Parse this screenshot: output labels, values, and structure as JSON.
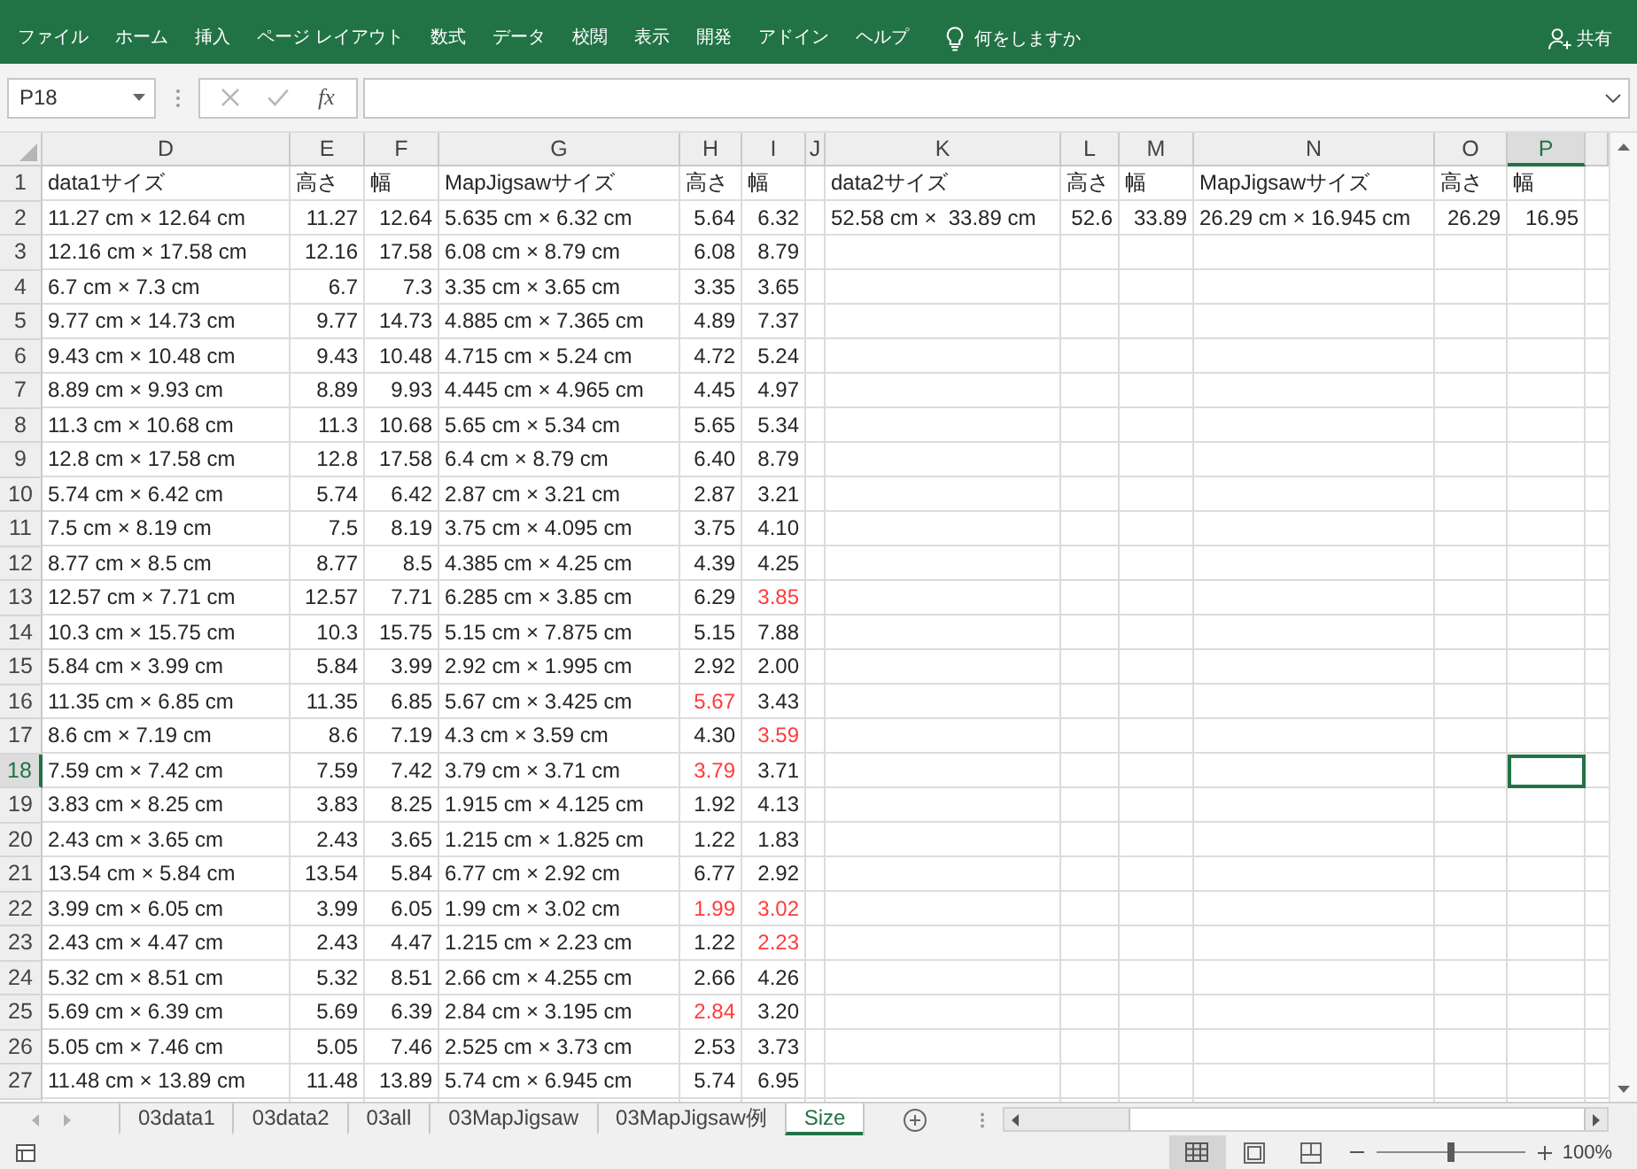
{
  "ribbon": {
    "tabs": [
      {
        "label": "ファイル",
        "selected": false
      },
      {
        "label": "ホーム",
        "selected": false
      },
      {
        "label": "挿入",
        "selected": false
      },
      {
        "label": "ページ レイアウト",
        "selected": false
      },
      {
        "label": "数式",
        "selected": false
      },
      {
        "label": "データ",
        "selected": false
      },
      {
        "label": "校閲",
        "selected": false
      },
      {
        "label": "表示",
        "selected": false
      },
      {
        "label": "開発",
        "selected": false
      },
      {
        "label": "アドイン",
        "selected": false
      },
      {
        "label": "ヘルプ",
        "selected": false
      }
    ],
    "tell_me": {
      "placeholder": "何をしますか"
    },
    "share": {
      "label": "共有"
    }
  },
  "formula_bar": {
    "name_box": {
      "value": "P18"
    },
    "cancel": {
      "disabled": true
    },
    "enter": {
      "disabled": true
    },
    "function_button": "fx"
  },
  "columns": [
    {
      "letter": "D",
      "kind": "text",
      "selected": false
    },
    {
      "letter": "E",
      "kind": "number",
      "selected": false
    },
    {
      "letter": "F",
      "kind": "number",
      "selected": false
    },
    {
      "letter": "G",
      "kind": "text",
      "selected": false
    },
    {
      "letter": "H",
      "kind": "number",
      "selected": false
    },
    {
      "letter": "I",
      "kind": "number",
      "selected": false
    },
    {
      "letter": "J",
      "kind": "spacer",
      "selected": false
    },
    {
      "letter": "K",
      "kind": "text",
      "selected": false
    },
    {
      "letter": "L",
      "kind": "number",
      "selected": false
    },
    {
      "letter": "M",
      "kind": "number",
      "selected": false
    },
    {
      "letter": "N",
      "kind": "text",
      "selected": false
    },
    {
      "letter": "O",
      "kind": "number",
      "selected": false
    },
    {
      "letter": "P",
      "kind": "number",
      "selected": true
    }
  ],
  "rows": [
    {
      "number": "1",
      "kind": "header",
      "selected": false,
      "cells": [
        {
          "text": "data1サイズ",
          "highlighted": false
        },
        {
          "text": "高さ",
          "highlighted": false
        },
        {
          "text": "幅",
          "highlighted": false
        },
        {
          "text": "MapJigsawサイズ",
          "highlighted": false
        },
        {
          "text": "高さ",
          "highlighted": false
        },
        {
          "text": "幅",
          "highlighted": false
        },
        {
          "text": "data2サイズ",
          "highlighted": false
        },
        {
          "text": "高さ",
          "highlighted": false
        },
        {
          "text": "幅",
          "highlighted": false
        },
        {
          "text": "MapJigsawサイズ",
          "highlighted": false
        },
        {
          "text": "高さ",
          "highlighted": false
        },
        {
          "text": "幅",
          "highlighted": false
        }
      ]
    },
    {
      "number": "2",
      "kind": "data",
      "selected": false,
      "cells": [
        {
          "text": "11.27 cm × 12.64 cm",
          "highlighted": false
        },
        {
          "text": "11.27",
          "highlighted": false
        },
        {
          "text": "12.64",
          "highlighted": false
        },
        {
          "text": "5.635 cm × 6.32 cm",
          "highlighted": false
        },
        {
          "text": "5.64",
          "highlighted": false
        },
        {
          "text": "6.32",
          "highlighted": false
        },
        {
          "text": "52.58 cm ×  33.89 cm",
          "highlighted": false
        },
        {
          "text": "52.6",
          "highlighted": false
        },
        {
          "text": "33.89",
          "highlighted": false
        },
        {
          "text": "26.29 cm × 16.945 cm",
          "highlighted": false
        },
        {
          "text": "26.29",
          "highlighted": false
        },
        {
          "text": "16.95",
          "highlighted": false
        }
      ]
    },
    {
      "number": "3",
      "kind": "data",
      "selected": false,
      "cells": [
        {
          "text": "12.16 cm × 17.58 cm",
          "highlighted": false
        },
        {
          "text": "12.16",
          "highlighted": false
        },
        {
          "text": "17.58",
          "highlighted": false
        },
        {
          "text": "6.08 cm × 8.79 cm",
          "highlighted": false
        },
        {
          "text": "6.08",
          "highlighted": false
        },
        {
          "text": "8.79",
          "highlighted": false
        }
      ]
    },
    {
      "number": "4",
      "kind": "data",
      "selected": false,
      "cells": [
        {
          "text": "6.7 cm × 7.3 cm",
          "highlighted": false
        },
        {
          "text": "6.7",
          "highlighted": false
        },
        {
          "text": "7.3",
          "highlighted": false
        },
        {
          "text": "3.35 cm × 3.65 cm",
          "highlighted": false
        },
        {
          "text": "3.35",
          "highlighted": false
        },
        {
          "text": "3.65",
          "highlighted": false
        }
      ]
    },
    {
      "number": "5",
      "kind": "data",
      "selected": false,
      "cells": [
        {
          "text": "9.77 cm × 14.73 cm",
          "highlighted": false
        },
        {
          "text": "9.77",
          "highlighted": false
        },
        {
          "text": "14.73",
          "highlighted": false
        },
        {
          "text": "4.885 cm × 7.365 cm",
          "highlighted": false
        },
        {
          "text": "4.89",
          "highlighted": false
        },
        {
          "text": "7.37",
          "highlighted": false
        }
      ]
    },
    {
      "number": "6",
      "kind": "data",
      "selected": false,
      "cells": [
        {
          "text": "9.43 cm × 10.48 cm",
          "highlighted": false
        },
        {
          "text": "9.43",
          "highlighted": false
        },
        {
          "text": "10.48",
          "highlighted": false
        },
        {
          "text": "4.715 cm × 5.24 cm",
          "highlighted": false
        },
        {
          "text": "4.72",
          "highlighted": false
        },
        {
          "text": "5.24",
          "highlighted": false
        }
      ]
    },
    {
      "number": "7",
      "kind": "data",
      "selected": false,
      "cells": [
        {
          "text": "8.89 cm × 9.93 cm",
          "highlighted": false
        },
        {
          "text": "8.89",
          "highlighted": false
        },
        {
          "text": "9.93",
          "highlighted": false
        },
        {
          "text": "4.445 cm × 4.965 cm",
          "highlighted": false
        },
        {
          "text": "4.45",
          "highlighted": false
        },
        {
          "text": "4.97",
          "highlighted": false
        }
      ]
    },
    {
      "number": "8",
      "kind": "data",
      "selected": false,
      "cells": [
        {
          "text": "11.3 cm × 10.68 cm",
          "highlighted": false
        },
        {
          "text": "11.3",
          "highlighted": false
        },
        {
          "text": "10.68",
          "highlighted": false
        },
        {
          "text": "5.65 cm × 5.34 cm",
          "highlighted": false
        },
        {
          "text": "5.65",
          "highlighted": false
        },
        {
          "text": "5.34",
          "highlighted": false
        }
      ]
    },
    {
      "number": "9",
      "kind": "data",
      "selected": false,
      "cells": [
        {
          "text": "12.8 cm × 17.58 cm",
          "highlighted": false
        },
        {
          "text": "12.8",
          "highlighted": false
        },
        {
          "text": "17.58",
          "highlighted": false
        },
        {
          "text": "6.4 cm × 8.79 cm",
          "highlighted": false
        },
        {
          "text": "6.40",
          "highlighted": false
        },
        {
          "text": "8.79",
          "highlighted": false
        }
      ]
    },
    {
      "number": "10",
      "kind": "data",
      "selected": false,
      "cells": [
        {
          "text": "5.74 cm × 6.42 cm",
          "highlighted": false
        },
        {
          "text": "5.74",
          "highlighted": false
        },
        {
          "text": "6.42",
          "highlighted": false
        },
        {
          "text": "2.87 cm × 3.21 cm",
          "highlighted": false
        },
        {
          "text": "2.87",
          "highlighted": false
        },
        {
          "text": "3.21",
          "highlighted": false
        }
      ]
    },
    {
      "number": "11",
      "kind": "data",
      "selected": false,
      "cells": [
        {
          "text": "7.5 cm × 8.19 cm",
          "highlighted": false
        },
        {
          "text": "7.5",
          "highlighted": false
        },
        {
          "text": "8.19",
          "highlighted": false
        },
        {
          "text": "3.75 cm × 4.095 cm",
          "highlighted": false
        },
        {
          "text": "3.75",
          "highlighted": false
        },
        {
          "text": "4.10",
          "highlighted": false
        }
      ]
    },
    {
      "number": "12",
      "kind": "data",
      "selected": false,
      "cells": [
        {
          "text": "8.77 cm × 8.5 cm",
          "highlighted": false
        },
        {
          "text": "8.77",
          "highlighted": false
        },
        {
          "text": "8.5",
          "highlighted": false
        },
        {
          "text": "4.385 cm × 4.25 cm",
          "highlighted": false
        },
        {
          "text": "4.39",
          "highlighted": false
        },
        {
          "text": "4.25",
          "highlighted": false
        }
      ]
    },
    {
      "number": "13",
      "kind": "data",
      "selected": false,
      "cells": [
        {
          "text": "12.57 cm × 7.71 cm",
          "highlighted": false
        },
        {
          "text": "12.57",
          "highlighted": false
        },
        {
          "text": "7.71",
          "highlighted": false
        },
        {
          "text": "6.285 cm × 3.85 cm",
          "highlighted": false
        },
        {
          "text": "6.29",
          "highlighted": false
        },
        {
          "text": "3.85",
          "highlighted": true
        }
      ]
    },
    {
      "number": "14",
      "kind": "data",
      "selected": false,
      "cells": [
        {
          "text": "10.3 cm × 15.75 cm",
          "highlighted": false
        },
        {
          "text": "10.3",
          "highlighted": false
        },
        {
          "text": "15.75",
          "highlighted": false
        },
        {
          "text": "5.15 cm × 7.875 cm",
          "highlighted": false
        },
        {
          "text": "5.15",
          "highlighted": false
        },
        {
          "text": "7.88",
          "highlighted": false
        }
      ]
    },
    {
      "number": "15",
      "kind": "data",
      "selected": false,
      "cells": [
        {
          "text": "5.84 cm × 3.99 cm",
          "highlighted": false
        },
        {
          "text": "5.84",
          "highlighted": false
        },
        {
          "text": "3.99",
          "highlighted": false
        },
        {
          "text": "2.92 cm × 1.995 cm",
          "highlighted": false
        },
        {
          "text": "2.92",
          "highlighted": false
        },
        {
          "text": "2.00",
          "highlighted": false
        }
      ]
    },
    {
      "number": "16",
      "kind": "data",
      "selected": false,
      "cells": [
        {
          "text": "11.35 cm × 6.85 cm",
          "highlighted": false
        },
        {
          "text": "11.35",
          "highlighted": false
        },
        {
          "text": "6.85",
          "highlighted": false
        },
        {
          "text": "5.67 cm × 3.425 cm",
          "highlighted": false
        },
        {
          "text": "5.67",
          "highlighted": true
        },
        {
          "text": "3.43",
          "highlighted": false
        }
      ]
    },
    {
      "number": "17",
      "kind": "data",
      "selected": false,
      "cells": [
        {
          "text": "8.6 cm × 7.19 cm",
          "highlighted": false
        },
        {
          "text": "8.6",
          "highlighted": false
        },
        {
          "text": "7.19",
          "highlighted": false
        },
        {
          "text": "4.3 cm × 3.59 cm",
          "highlighted": false
        },
        {
          "text": "4.30",
          "highlighted": false
        },
        {
          "text": "3.59",
          "highlighted": true
        }
      ]
    },
    {
      "number": "18",
      "kind": "data",
      "selected": true,
      "cells": [
        {
          "text": "7.59 cm × 7.42 cm",
          "highlighted": false
        },
        {
          "text": "7.59",
          "highlighted": false
        },
        {
          "text": "7.42",
          "highlighted": false
        },
        {
          "text": "3.79 cm × 3.71 cm",
          "highlighted": false
        },
        {
          "text": "3.79",
          "highlighted": true
        },
        {
          "text": "3.71",
          "highlighted": false
        }
      ]
    },
    {
      "number": "19",
      "kind": "data",
      "selected": false,
      "cells": [
        {
          "text": "3.83 cm × 8.25 cm",
          "highlighted": false
        },
        {
          "text": "3.83",
          "highlighted": false
        },
        {
          "text": "8.25",
          "highlighted": false
        },
        {
          "text": "1.915 cm × 4.125 cm",
          "highlighted": false
        },
        {
          "text": "1.92",
          "highlighted": false
        },
        {
          "text": "4.13",
          "highlighted": false
        }
      ]
    },
    {
      "number": "20",
      "kind": "data",
      "selected": false,
      "cells": [
        {
          "text": "2.43 cm × 3.65 cm",
          "highlighted": false
        },
        {
          "text": "2.43",
          "highlighted": false
        },
        {
          "text": "3.65",
          "highlighted": false
        },
        {
          "text": "1.215 cm × 1.825 cm",
          "highlighted": false
        },
        {
          "text": "1.22",
          "highlighted": false
        },
        {
          "text": "1.83",
          "highlighted": false
        }
      ]
    },
    {
      "number": "21",
      "kind": "data",
      "selected": false,
      "cells": [
        {
          "text": "13.54 cm × 5.84 cm",
          "highlighted": false
        },
        {
          "text": "13.54",
          "highlighted": false
        },
        {
          "text": "5.84",
          "highlighted": false
        },
        {
          "text": "6.77 cm × 2.92 cm",
          "highlighted": false
        },
        {
          "text": "6.77",
          "highlighted": false
        },
        {
          "text": "2.92",
          "highlighted": false
        }
      ]
    },
    {
      "number": "22",
      "kind": "data",
      "selected": false,
      "cells": [
        {
          "text": "3.99 cm × 6.05 cm",
          "highlighted": false
        },
        {
          "text": "3.99",
          "highlighted": false
        },
        {
          "text": "6.05",
          "highlighted": false
        },
        {
          "text": "1.99 cm × 3.02 cm",
          "highlighted": false
        },
        {
          "text": "1.99",
          "highlighted": true
        },
        {
          "text": "3.02",
          "highlighted": true
        }
      ]
    },
    {
      "number": "23",
      "kind": "data",
      "selected": false,
      "cells": [
        {
          "text": "2.43 cm × 4.47 cm",
          "highlighted": false
        },
        {
          "text": "2.43",
          "highlighted": false
        },
        {
          "text": "4.47",
          "highlighted": false
        },
        {
          "text": "1.215 cm × 2.23 cm",
          "highlighted": false
        },
        {
          "text": "1.22",
          "highlighted": false
        },
        {
          "text": "2.23",
          "highlighted": true
        }
      ]
    },
    {
      "number": "24",
      "kind": "data",
      "selected": false,
      "cells": [
        {
          "text": "5.32 cm × 8.51 cm",
          "highlighted": false
        },
        {
          "text": "5.32",
          "highlighted": false
        },
        {
          "text": "8.51",
          "highlighted": false
        },
        {
          "text": "2.66 cm × 4.255 cm",
          "highlighted": false
        },
        {
          "text": "2.66",
          "highlighted": false
        },
        {
          "text": "4.26",
          "highlighted": false
        }
      ]
    },
    {
      "number": "25",
      "kind": "data",
      "selected": false,
      "cells": [
        {
          "text": "5.69 cm × 6.39 cm",
          "highlighted": false
        },
        {
          "text": "5.69",
          "highlighted": false
        },
        {
          "text": "6.39",
          "highlighted": false
        },
        {
          "text": "2.84 cm × 3.195 cm",
          "highlighted": false
        },
        {
          "text": "2.84",
          "highlighted": true
        },
        {
          "text": "3.20",
          "highlighted": false
        }
      ]
    },
    {
      "number": "26",
      "kind": "data",
      "selected": false,
      "cells": [
        {
          "text": "5.05 cm × 7.46 cm",
          "highlighted": false
        },
        {
          "text": "5.05",
          "highlighted": false
        },
        {
          "text": "7.46",
          "highlighted": false
        },
        {
          "text": "2.525 cm × 3.73 cm",
          "highlighted": false
        },
        {
          "text": "2.53",
          "highlighted": false
        },
        {
          "text": "3.73",
          "highlighted": false
        }
      ]
    },
    {
      "number": "27",
      "kind": "data",
      "selected": false,
      "cells": [
        {
          "text": "11.48 cm × 13.89 cm",
          "highlighted": false
        },
        {
          "text": "11.48",
          "highlighted": false
        },
        {
          "text": "13.89",
          "highlighted": false
        },
        {
          "text": "5.74 cm × 6.945 cm",
          "highlighted": false
        },
        {
          "text": "5.74",
          "highlighted": false
        },
        {
          "text": "6.95",
          "highlighted": false
        }
      ]
    }
  ],
  "sheet_tabs": [
    {
      "label": "03data1",
      "selected": false
    },
    {
      "label": "03data2",
      "selected": false
    },
    {
      "label": "03all",
      "selected": false
    },
    {
      "label": "03MapJigsaw",
      "selected": false
    },
    {
      "label": "03MapJigsaw例",
      "selected": false
    },
    {
      "label": "Size",
      "selected": true
    }
  ],
  "status_bar": {
    "views": [
      {
        "kind": "normal",
        "selected": true
      },
      {
        "kind": "page_layout",
        "selected": false
      },
      {
        "kind": "page_break",
        "selected": false
      }
    ],
    "zoom": {
      "level": 0.5,
      "reading": "100%"
    }
  }
}
